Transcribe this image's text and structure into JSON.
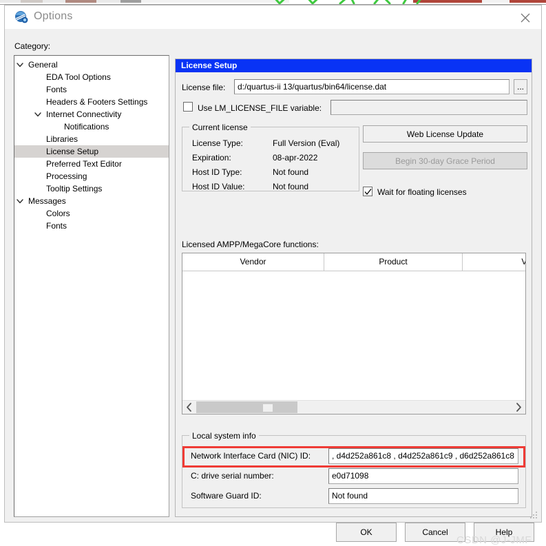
{
  "window": {
    "title": "Options",
    "icon": "quartus-globe-icon",
    "close_label": "Close"
  },
  "sidebar": {
    "label": "Category:",
    "items": [
      {
        "label": "General",
        "depth": 0,
        "twisty": "chevron-down",
        "selected": false,
        "name": "sidebar-item-general"
      },
      {
        "label": "EDA Tool Options",
        "depth": 1,
        "twisty": "",
        "selected": false,
        "name": "sidebar-item-eda-tool-options"
      },
      {
        "label": "Fonts",
        "depth": 1,
        "twisty": "",
        "selected": false,
        "name": "sidebar-item-fonts"
      },
      {
        "label": "Headers & Footers Settings",
        "depth": 1,
        "twisty": "",
        "selected": false,
        "name": "sidebar-item-headers-footers-settings"
      },
      {
        "label": "Internet Connectivity",
        "depth": 1,
        "twisty": "chevron-down",
        "selected": false,
        "name": "sidebar-item-internet-connectivity"
      },
      {
        "label": "Notifications",
        "depth": 2,
        "twisty": "",
        "selected": false,
        "name": "sidebar-item-notifications"
      },
      {
        "label": "Libraries",
        "depth": 1,
        "twisty": "",
        "selected": false,
        "name": "sidebar-item-libraries"
      },
      {
        "label": "License Setup",
        "depth": 1,
        "twisty": "",
        "selected": true,
        "name": "sidebar-item-license-setup"
      },
      {
        "label": "Preferred Text Editor",
        "depth": 1,
        "twisty": "",
        "selected": false,
        "name": "sidebar-item-preferred-text-editor"
      },
      {
        "label": "Processing",
        "depth": 1,
        "twisty": "",
        "selected": false,
        "name": "sidebar-item-processing"
      },
      {
        "label": "Tooltip Settings",
        "depth": 1,
        "twisty": "",
        "selected": false,
        "name": "sidebar-item-tooltip-settings"
      },
      {
        "label": "Messages",
        "depth": 0,
        "twisty": "chevron-down",
        "selected": false,
        "name": "sidebar-item-messages"
      },
      {
        "label": "Colors",
        "depth": 1,
        "twisty": "",
        "selected": false,
        "name": "sidebar-item-colors"
      },
      {
        "label": "Fonts",
        "depth": 1,
        "twisty": "",
        "selected": false,
        "name": "sidebar-item-messages-fonts"
      }
    ]
  },
  "pane": {
    "title": "License Setup",
    "license_file": {
      "label": "License file:",
      "value": "d:/quartus-ii 13/quartus/bin64/license.dat",
      "browse_label": "..."
    },
    "lm_license_file": {
      "label": "Use LM_LICENSE_FILE variable:",
      "checked": false,
      "value": ""
    },
    "current_license": {
      "title": "Current license",
      "rows": [
        {
          "label": "License Type:",
          "value": "Full Version (Eval)"
        },
        {
          "label": "Expiration:",
          "value": "08-apr-2022"
        },
        {
          "label": "Host ID Type:",
          "value": "Not found"
        },
        {
          "label": "Host ID Value:",
          "value": "Not found"
        }
      ],
      "web_update_label": "Web License Update",
      "grace_period_label": "Begin 30-day Grace Period",
      "grace_period_enabled": false,
      "wait_floating": {
        "label": "Wait for floating licenses",
        "checked": true
      }
    },
    "licensed_functions": {
      "label": "Licensed AMPP/MegaCore functions:",
      "columns": [
        "Vendor",
        "Product",
        "Versi"
      ],
      "rows": []
    },
    "local_system_info": {
      "title": "Local system info",
      "rows": [
        {
          "label": "Network Interface Card (NIC) ID:",
          "value": ", d4d252a861c8 , d4d252a861c9 , d6d252a861c8",
          "highlighted": true
        },
        {
          "label": "C: drive serial number:",
          "value": "e0d71098",
          "highlighted": false
        },
        {
          "label": "Software Guard ID:",
          "value": "Not found",
          "highlighted": false
        }
      ]
    }
  },
  "footer": {
    "ok_label": "OK",
    "cancel_label": "Cancel",
    "help_label": "Help"
  },
  "watermark": "CSDN @J-JMF",
  "colors": {
    "pane_header_bg": "#0933f5",
    "highlight_red": "#ef3b35",
    "selection_gray": "#d6d3d1",
    "dialog_bg": "#f0f0f0"
  }
}
